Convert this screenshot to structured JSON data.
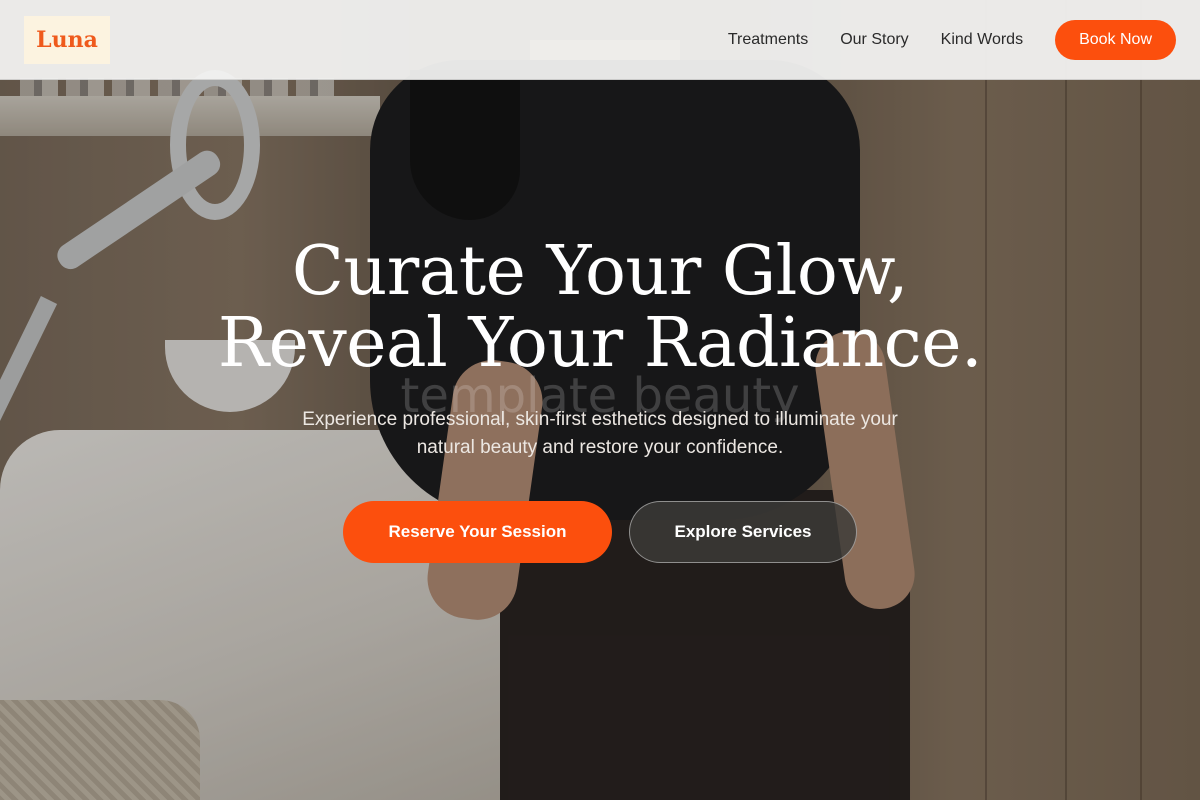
{
  "brand": {
    "logo_text": "Luna",
    "accent": "#fc4f0d"
  },
  "nav": {
    "links": [
      "Treatments",
      "Our Story",
      "Kind Words"
    ],
    "cta_label": "Book Now"
  },
  "hero": {
    "title_line1": "Curate Your Glow,",
    "title_line2": "Reveal Your Radiance.",
    "watermark": "template beauty",
    "subtitle_line1": "Experience professional, skin-first esthetics designed to illuminate your",
    "subtitle_line2": "natural beauty and restore your confidence.",
    "primary_cta": "Reserve Your Session",
    "secondary_cta": "Explore Services"
  }
}
